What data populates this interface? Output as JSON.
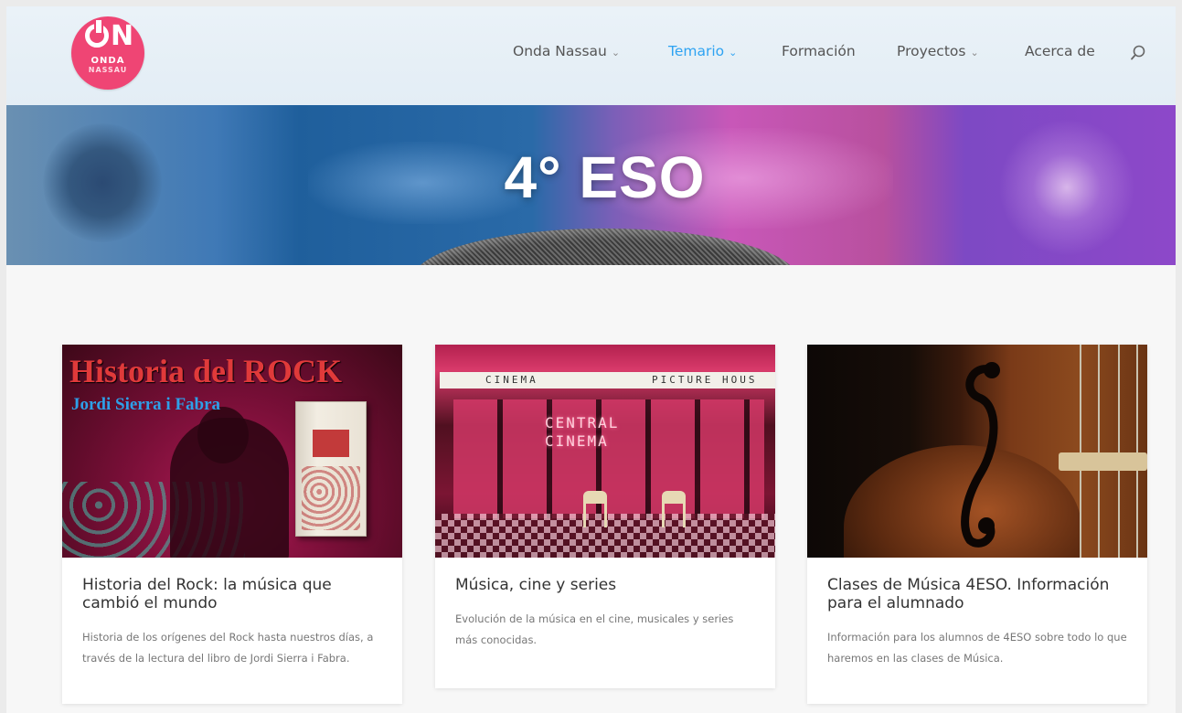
{
  "header": {
    "logo": {
      "main": "ON",
      "line1": "ONDA",
      "line2": "NASSAU",
      "brand_color": "#ef4574"
    },
    "nav": [
      {
        "label": "Onda Nassau",
        "has_dropdown": true,
        "active": false
      },
      {
        "label": "Temario",
        "has_dropdown": true,
        "active": true
      },
      {
        "label": "Formación",
        "has_dropdown": false,
        "active": false
      },
      {
        "label": "Proyectos",
        "has_dropdown": true,
        "active": false
      },
      {
        "label": "Acerca de",
        "has_dropdown": false,
        "active": false
      }
    ],
    "chevron": "⌄",
    "accent_color": "#2ea3f2"
  },
  "hero": {
    "title": "4° ESO"
  },
  "cards": [
    {
      "title": "Historia del Rock: la música que cambió el mundo",
      "excerpt": "Historia de los orígenes del Rock hasta nuestros días, a través de la lectura del libro de Jordi Sierra i Fabra.",
      "image": {
        "title": "Historia del ROCK",
        "author": "Jordi Sierra i Fabra"
      }
    },
    {
      "title": "Música, cine y series",
      "excerpt": "Evolución de la música en el cine, musicales y series más conocidas.",
      "image": {
        "sign_left": "CINEMA",
        "sign_right": "PICTURE HOUS",
        "neon_1": "CENTRAL",
        "neon_2": "CINEMA"
      }
    },
    {
      "title": "Clases de Música 4ESO. Información para el alumnado",
      "excerpt": "Información para los alumnos de 4ESO sobre todo lo que haremos en las clases de Música."
    }
  ]
}
